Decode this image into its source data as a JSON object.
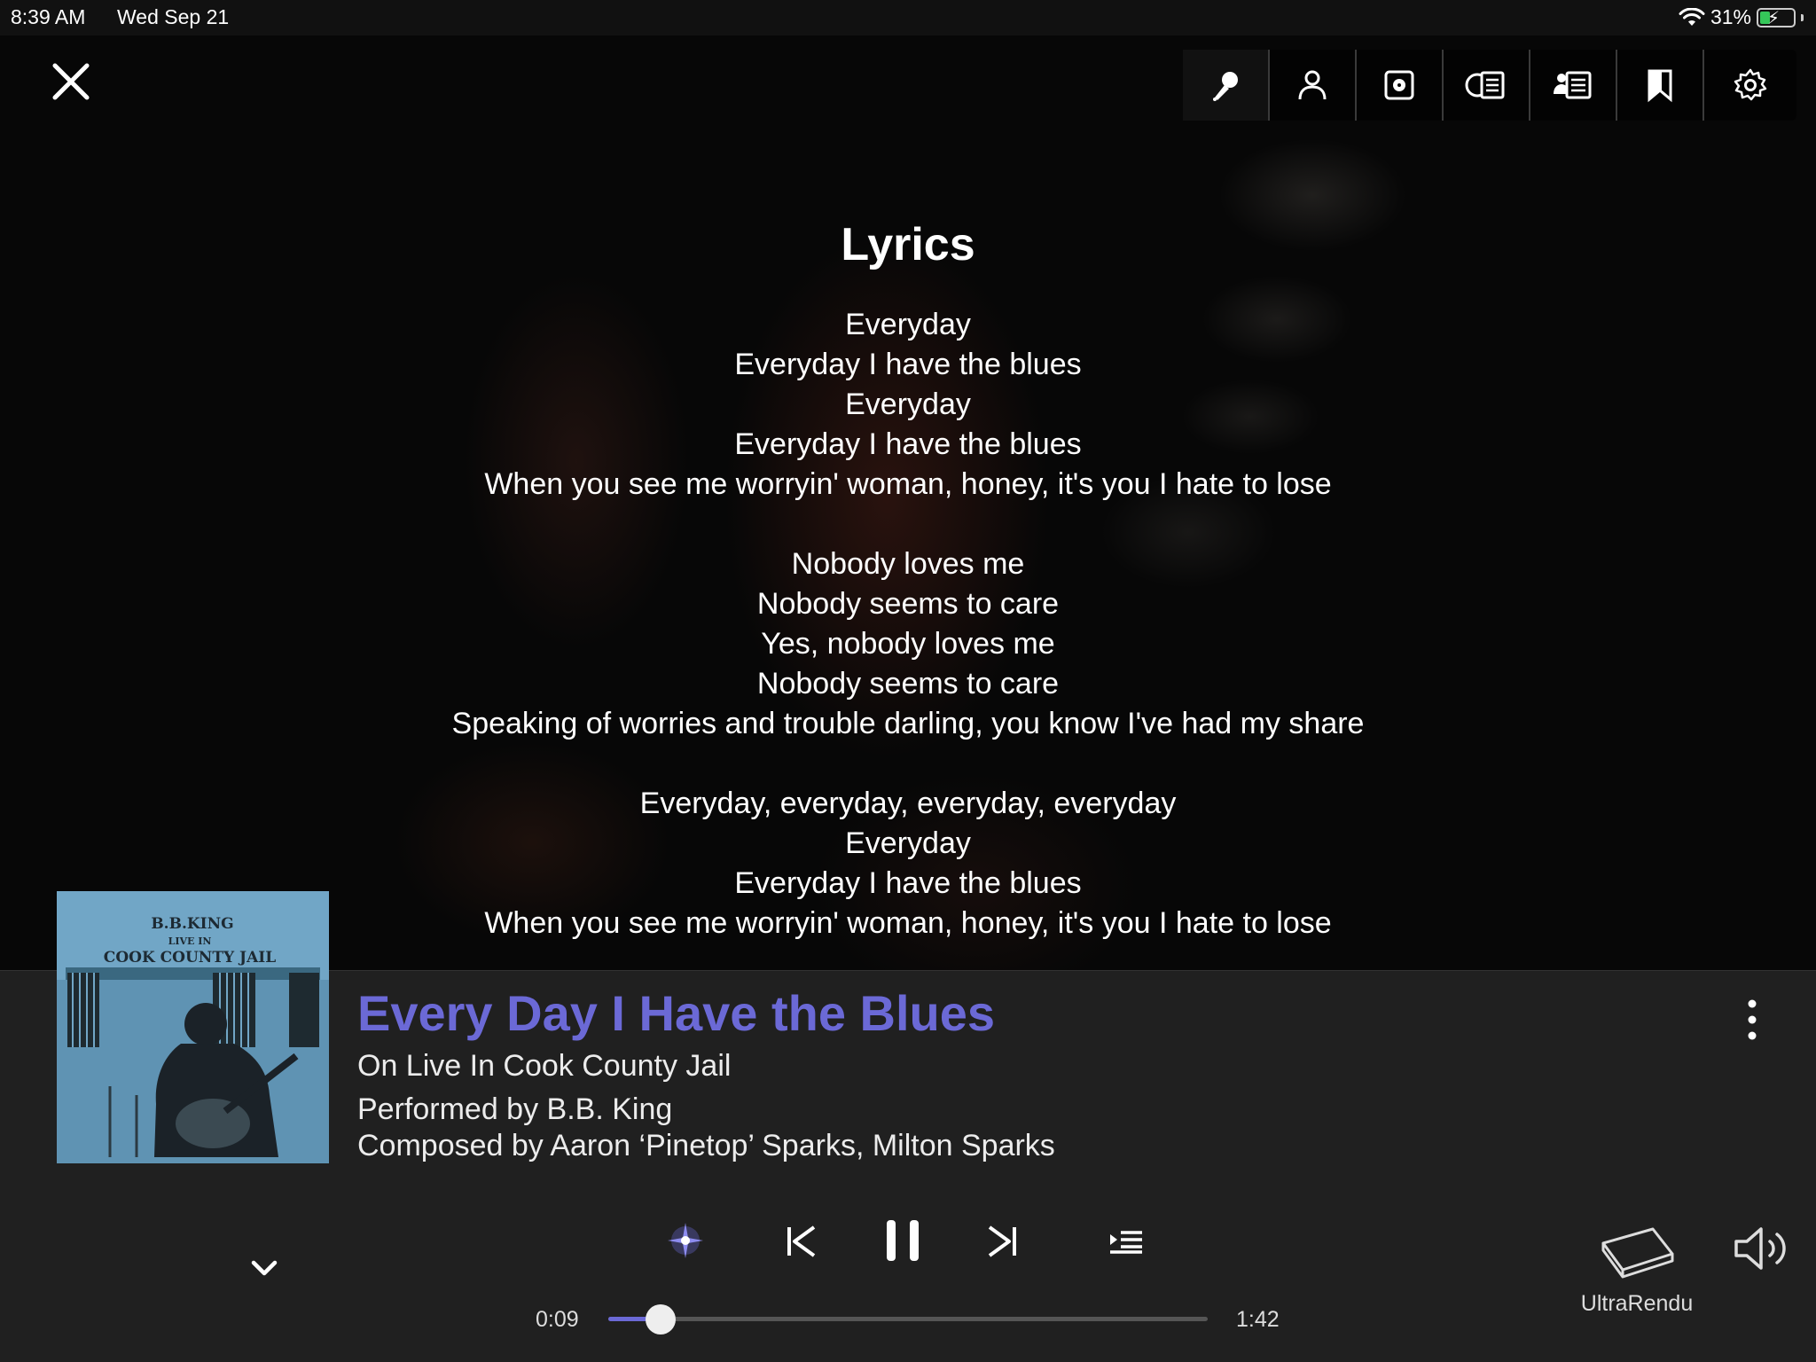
{
  "status_bar": {
    "time": "8:39 AM",
    "date": "Wed Sep 21",
    "battery": "31%",
    "battery_level": 0.31
  },
  "toolbar": {
    "items": [
      "lyrics-icon",
      "artist-icon",
      "album-icon",
      "album-credits-icon",
      "track-credits-icon",
      "bookmark-icon",
      "settings-icon"
    ],
    "active": "lyrics-icon"
  },
  "lyrics": {
    "title": "Lyrics",
    "lines": [
      "Everyday",
      "Everyday I have the blues",
      "Everyday",
      "Everyday I have the blues",
      "When you see me worryin' woman, honey, it's you I hate to lose",
      "",
      "Nobody loves me",
      "Nobody seems to care",
      "Yes, nobody loves me",
      "Nobody seems to care",
      "Speaking of worries and trouble darling, you know I've had my share",
      "",
      "Everyday, everyday, everyday, everyday",
      "Everyday",
      "Everyday I have the blues",
      "When you see me worryin' woman, honey, it's you I hate to lose"
    ]
  },
  "album_art": {
    "artist_text": "B.B.KING",
    "subtitle_text": "LIVE IN",
    "title_text": "COOK COUNTY JAIL"
  },
  "track": {
    "title": "Every Day I Have the Blues",
    "album": "On Live In Cook County Jail",
    "performer": "Performed by B.B. King",
    "composer": "Composed by Aaron ‘Pinetop’ Sparks, Milton Sparks"
  },
  "playback": {
    "elapsed": "0:09",
    "total": "1:42",
    "progress": 0.088
  },
  "zone": {
    "name": "UltraRendu"
  },
  "colors": {
    "accent": "#6b69d6",
    "panel": "#202020"
  }
}
